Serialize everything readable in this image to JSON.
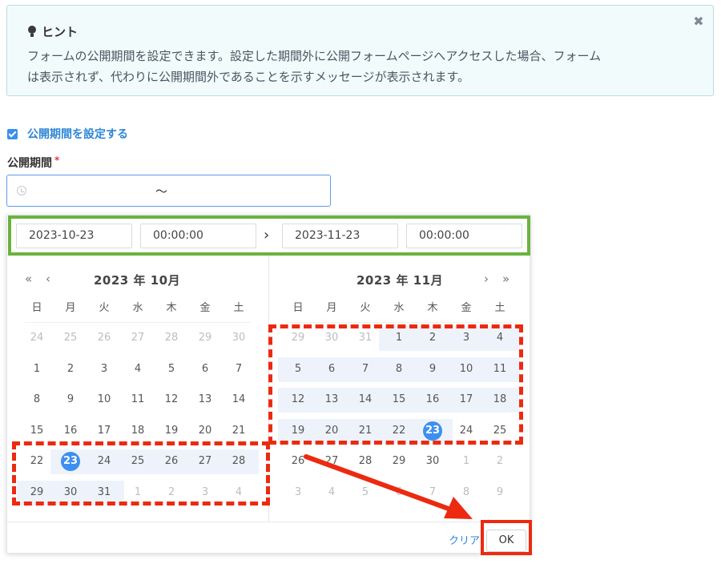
{
  "hint": {
    "title": "ヒント",
    "line1": "フォームの公開期間を設定できます。設定した期間外に公開フォームページへアクセスした場合、フォーム",
    "line2": "は表示されず、代わりに公開期間外であることを示すメッセージが表示されます。",
    "close_glyph": "✖"
  },
  "checkbox": {
    "label": "公開期間を設定する",
    "checked": true
  },
  "field": {
    "label": "公開期間",
    "required_mark": "*",
    "separator": "〜"
  },
  "picker": {
    "start_date": "2023-10-23",
    "start_time": "00:00:00",
    "end_date": "2023-11-23",
    "end_time": "00:00:00",
    "arrow_glyph": "›",
    "weekdays": [
      "日",
      "月",
      "火",
      "水",
      "木",
      "金",
      "土"
    ],
    "left": {
      "title": "2023 年 10月",
      "nav_prev_year": "«",
      "nav_prev_month": "‹",
      "days": [
        [
          "24",
          "25",
          "26",
          "27",
          "28",
          "29",
          "30"
        ],
        [
          "1",
          "2",
          "3",
          "4",
          "5",
          "6",
          "7"
        ],
        [
          "8",
          "9",
          "10",
          "11",
          "12",
          "13",
          "14"
        ],
        [
          "15",
          "16",
          "17",
          "18",
          "19",
          "20",
          "21"
        ],
        [
          "22",
          "23",
          "24",
          "25",
          "26",
          "27",
          "28"
        ],
        [
          "29",
          "30",
          "31",
          "1",
          "2",
          "3",
          "4"
        ]
      ]
    },
    "right": {
      "title": "2023 年 11月",
      "nav_next_month": "›",
      "nav_next_year": "»",
      "days": [
        [
          "29",
          "30",
          "31",
          "1",
          "2",
          "3",
          "4"
        ],
        [
          "5",
          "6",
          "7",
          "8",
          "9",
          "10",
          "11"
        ],
        [
          "12",
          "13",
          "14",
          "15",
          "16",
          "17",
          "18"
        ],
        [
          "19",
          "20",
          "21",
          "22",
          "23",
          "24",
          "25"
        ],
        [
          "26",
          "27",
          "28",
          "29",
          "30",
          "1",
          "2"
        ],
        [
          "3",
          "4",
          "5",
          "6",
          "7",
          "8",
          "9"
        ]
      ]
    },
    "clear_label": "クリア",
    "ok_label": "OK"
  },
  "colors": {
    "accent": "#3d8ff0",
    "highlight_red": "#ec2a10",
    "highlight_green": "#6bb23f",
    "range_bg": "#eef3fb"
  }
}
